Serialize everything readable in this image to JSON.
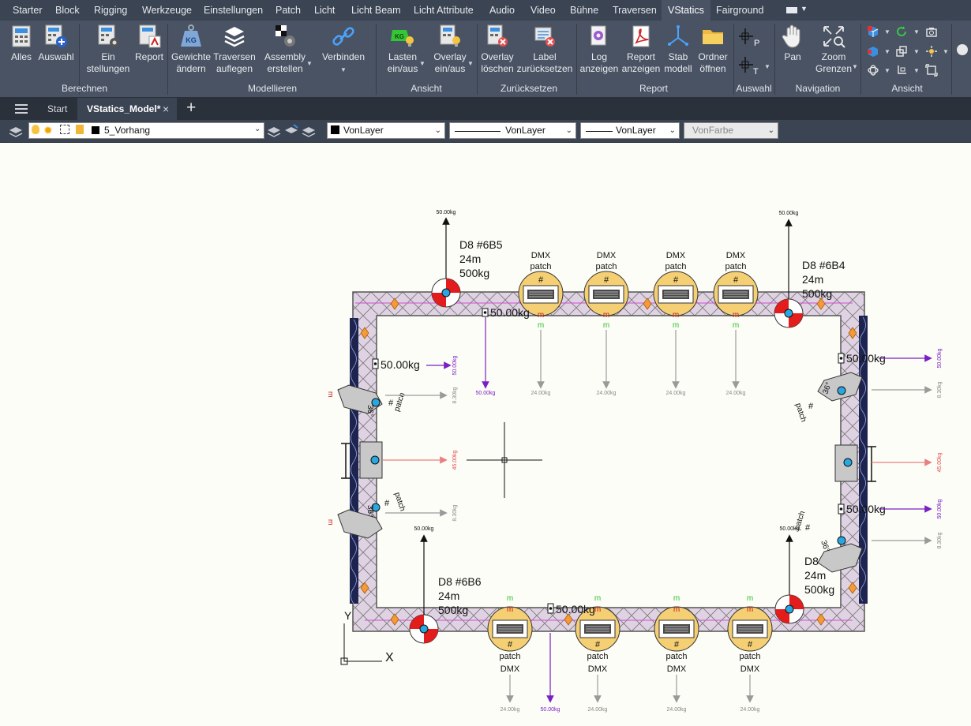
{
  "menu": {
    "tabs": [
      "Starter",
      "Block",
      "Rigging",
      "Werkzeuge",
      "Einstellungen",
      "Patch",
      "Licht",
      "Licht Beam",
      "Licht Attribute",
      "Audio",
      "Video",
      "Bühne",
      "Traversen",
      "VStatics",
      "Fairground"
    ],
    "active": "VStatics"
  },
  "ribbon": {
    "groups": {
      "berechnen": "Berechnen",
      "modellieren": "Modellieren",
      "ansicht": "Ansicht",
      "zuruecksetzen": "Zurücksetzen",
      "report": "Report",
      "auswahl": "Auswahl",
      "navigation": "Navigation",
      "ansicht2": "Ansicht"
    },
    "buttons": {
      "alles": "Alles",
      "auswahl": "Auswahl",
      "ein1": "Ein",
      "ein2": "stellungen",
      "report": "Report",
      "gew1": "Gewichte",
      "gew2": "ändern",
      "trav1": "Traversen",
      "trav2": "auflegen",
      "ass1": "Assembly",
      "ass2": "erstellen",
      "verbinden": "Verbinden",
      "last1": "Lasten",
      "last2": "ein/aus",
      "ov1": "Overlay",
      "ov2": "ein/aus",
      "ovl1": "Overlay",
      "ovl2": "löschen",
      "lab1": "Label",
      "lab2": "zurücksetzen",
      "log1": "Log",
      "log2": "anzeigen",
      "rep1": "Report",
      "rep2": "anzeigen",
      "stab1": "Stab",
      "stab2": "modell",
      "ord1": "Ordner",
      "ord2": "öffnen",
      "pan": "Pan",
      "zoom1": "Zoom",
      "zoom2": "Grenzen"
    }
  },
  "doctabs": {
    "start": "Start",
    "model": "VStatics_Model*"
  },
  "layerbar": {
    "layer": "5_Vorhang",
    "color": "VonLayer",
    "linetype": "VonLayer",
    "lineweight": "VonLayer",
    "plotstyle": "VonFarbe"
  },
  "drawing": {
    "pick_weight": "50.00kg",
    "load_small": "50.00kg",
    "dmx_weight": "24.00kg",
    "side_weight": "8.30kg",
    "center_weight": "45.00kg",
    "hoist_tl": [
      "D8  #6B5",
      "24m",
      "500kg"
    ],
    "hoist_tr": [
      "D8  #6B4",
      "24m",
      "500kg"
    ],
    "hoist_bl": [
      "D8  #6B6",
      "24m",
      "500kg"
    ],
    "hoist_br": [
      "D8  #6B7",
      "24m",
      "500kg"
    ],
    "dmx": "DMX",
    "patch": "patch",
    "hash": "#",
    "m": "m",
    "lens": "36°",
    "axis_x": "X",
    "axis_y": "Y"
  },
  "colors": {
    "ribbon_bg": "#4a5363",
    "menubar_bg": "#3b4453",
    "canvas_bg": "#fdfdf7",
    "truss_fill": "#dfd3e3",
    "hoist_red": "#e31c1c",
    "fixture_yellow": "#f5cf73",
    "purple_load": "#7a1fc4",
    "grey_load": "#9a9a9a",
    "red_load": "#e88080",
    "green_label": "#2fbf2f",
    "red_label": "#c01818",
    "curtain_blue": "#1d2450"
  }
}
